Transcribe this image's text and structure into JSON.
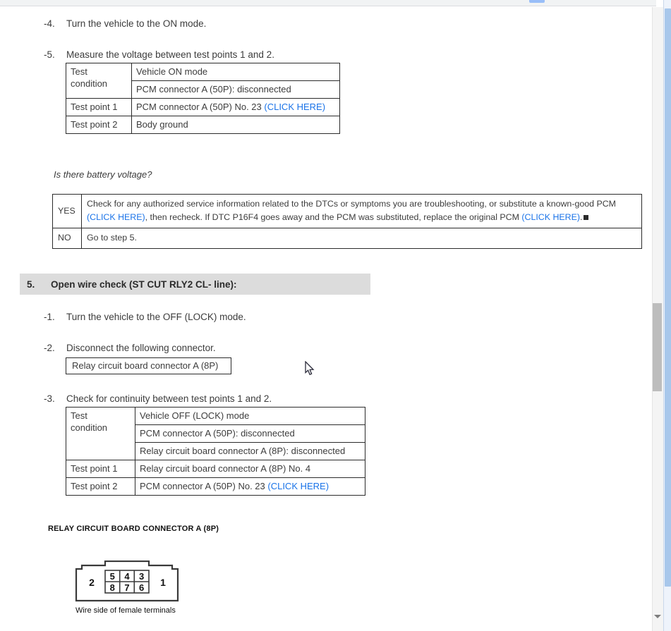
{
  "window": {
    "doc_scrollbar_name": "document-vertical-scrollbar",
    "window_scrollbar_name": "window-vertical-scrollbar"
  },
  "steps": {
    "s4": {
      "num": "-4.",
      "text": "Turn the vehicle to the ON mode."
    },
    "s5": {
      "num": "-5.",
      "text": "Measure the voltage between test points 1 and 2."
    }
  },
  "table_voltage": {
    "rows": [
      {
        "label": "Test\ncondition",
        "value": "Vehicle ON mode"
      },
      {
        "label": "",
        "value": "PCM connector A (50P): disconnected"
      },
      {
        "label": "Test point 1",
        "value": "PCM connector A (50P) No. 23 ",
        "link": "(CLICK HERE)"
      },
      {
        "label": "Test point 2",
        "value": "Body ground"
      }
    ],
    "label_col_1": "Test",
    "label_col_2": "condition"
  },
  "question": "Is there battery voltage?",
  "yesno": {
    "yes_key": "YES",
    "yes_part1": "Check for any authorized service information related to the DTCs or symptoms you are troubleshooting, or substitute a known-good PCM ",
    "yes_link1": "(CLICK HERE)",
    "yes_part2": ", then recheck. If DTC P16F4 goes away and the PCM was substituted, replace the original PCM ",
    "yes_link2": "(CLICK HERE)",
    "yes_part3": ".",
    "no_key": "NO",
    "no_text": "Go to step 5."
  },
  "section5": {
    "number": "5.",
    "title": "Open wire check (ST CUT RLY2 CL- line):",
    "sub1": {
      "num": "-1.",
      "text": "Turn the vehicle to the OFF (LOCK) mode."
    },
    "sub2": {
      "num": "-2.",
      "text": "Disconnect the following connector."
    },
    "callout": "Relay circuit board connector A (8P)",
    "sub3": {
      "num": "-3.",
      "text": "Check for continuity between test points 1 and 2."
    }
  },
  "table_continuity": {
    "label_col_1": "Test",
    "label_col_2": "condition",
    "rows": [
      {
        "label": "",
        "value": "Vehicle OFF (LOCK) mode"
      },
      {
        "label": "",
        "value": "PCM connector A (50P): disconnected"
      },
      {
        "label": "",
        "value": "Relay circuit board connector A (8P): disconnected"
      },
      {
        "label": "Test point 1",
        "value": "Relay circuit board connector A (8P) No. 4"
      },
      {
        "label": "Test point 2",
        "value": "PCM connector A (50P) No. 23 ",
        "link": "(CLICK HERE)"
      }
    ]
  },
  "connector_figure": {
    "title": "RELAY CIRCUIT BOARD CONNECTOR A (8P)",
    "caption": "Wire side of female terminals",
    "pin_left": "2",
    "pin_right": "1",
    "pins_top": [
      "5",
      "4",
      "3"
    ],
    "pins_bottom": [
      "8",
      "7",
      "6"
    ]
  },
  "colors": {
    "link": "#1a73e8",
    "section_header_bg": "#dcdcdc",
    "text": "#3c3c3c",
    "border": "#2b2b2b",
    "scrollbar_thumb": "#bdbdbd",
    "window_scrollbar_thumb": "#a8c7eb"
  }
}
